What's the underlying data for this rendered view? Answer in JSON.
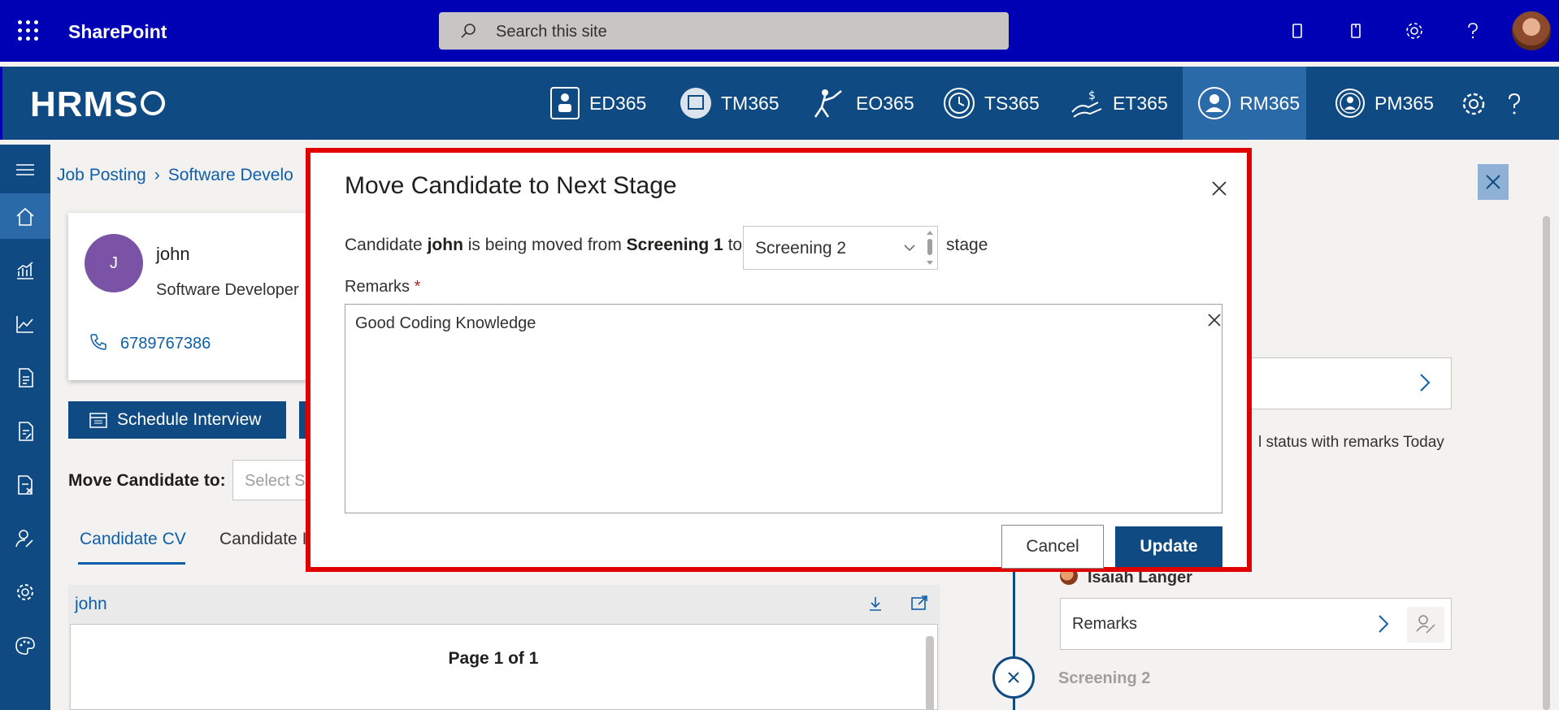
{
  "sharepoint": {
    "app_title": "SharePoint",
    "search_placeholder": "Search this site"
  },
  "hrms": {
    "logo": "HRMS",
    "nav": [
      {
        "label": "ED365",
        "icon": "employee-directory-icon"
      },
      {
        "label": "TM365",
        "icon": "task-management-icon"
      },
      {
        "label": "EO365",
        "icon": "onboarding-icon"
      },
      {
        "label": "TS365",
        "icon": "timesheet-icon"
      },
      {
        "label": "ET365",
        "icon": "expense-icon"
      },
      {
        "label": "RM365",
        "icon": "recruitment-icon",
        "active": true
      },
      {
        "label": "PM365",
        "icon": "performance-icon"
      }
    ]
  },
  "breadcrumb": {
    "root": "Job Posting",
    "current": "Software Develo"
  },
  "candidate": {
    "initial": "J",
    "name": "john",
    "role": "Software Developer",
    "phone": "6789767386"
  },
  "actions": {
    "schedule_label": "Schedule Interview",
    "move_label": "Move Candidate to:",
    "move_placeholder": "Select St"
  },
  "tabs": [
    {
      "label": "Candidate CV",
      "active": true
    },
    {
      "label": "Candidate I"
    }
  ],
  "cv": {
    "title": "john",
    "page_label": "Page 1 of 1"
  },
  "right_panel": {
    "status_text": "l status with remarks  Today",
    "person": "Isaiah Langer",
    "remarks_label": "Remarks",
    "stage_label": "Screening 2"
  },
  "dialog": {
    "title": "Move Candidate to Next Stage",
    "text_prefix": "Candidate ",
    "candidate": "john",
    "text_mid": " is being moved from ",
    "from_stage": "Screening 1",
    "text_to": " to",
    "to_stage": "Screening 2",
    "stage_word": "stage",
    "remarks_label": "Remarks",
    "required_mark": "*",
    "remarks_value": "Good Coding Knowledge",
    "cancel_label": "Cancel",
    "update_label": "Update"
  },
  "colors": {
    "sharepoint_bar": "#0000b4",
    "hrms_bar": "#0f4a82",
    "accent": "#0f5ea8",
    "highlight_border": "#e00000"
  }
}
